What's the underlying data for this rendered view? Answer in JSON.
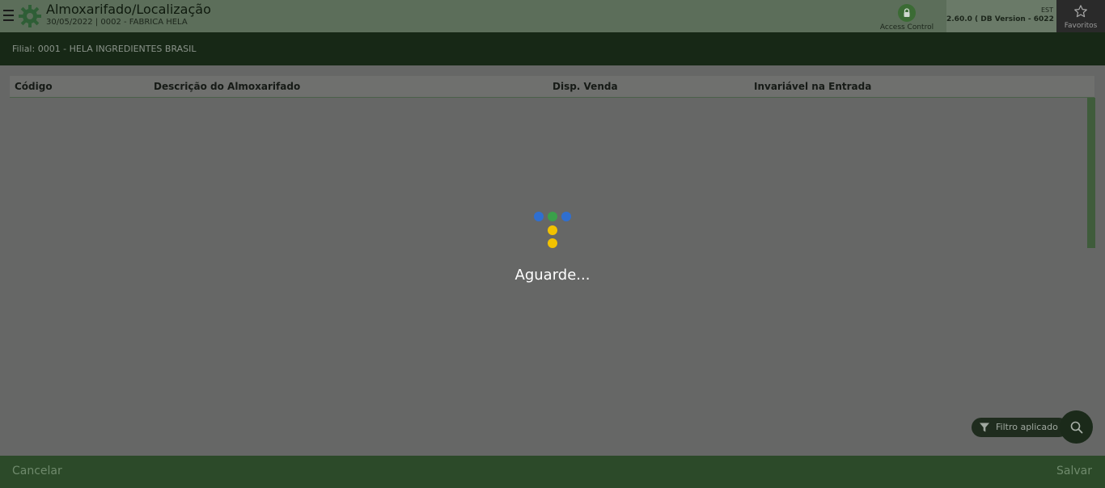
{
  "header": {
    "title": "Almoxarifado/Localização",
    "subtitle": "30/05/2022 | 0002 - FABRICA HELA",
    "access_control_label": "Access Control",
    "version_env": "EST",
    "version_text": "2.60.0 ( DB Version - 6022 )",
    "favorites_label": "Favoritos"
  },
  "filial": {
    "text": "Filial: 0001 - HELA INGREDIENTES BRASIL"
  },
  "table": {
    "columns": [
      "Código",
      "Descrição do Almoxarifado",
      "Disp. Venda",
      "Invariável na Entrada"
    ]
  },
  "loader": {
    "text": "Aguarde...",
    "dot_colors": [
      "#2f6fd0",
      "#3aa04a",
      "#2f6fd0",
      "#f2c200",
      "#f2c200"
    ]
  },
  "filter": {
    "label": "Filtro aplicado"
  },
  "footer": {
    "cancel_label": "Cancelar",
    "save_label": "Salvar"
  },
  "icons": {
    "menu": "menu-icon",
    "logo": "gear-logo-icon",
    "lock": "lock-icon",
    "star": "star-icon",
    "filter": "filter-icon",
    "search": "search-icon"
  },
  "colors": {
    "header_bg": "#5c6e5a",
    "filial_bg": "#172816",
    "footer_bg": "#2c4a29",
    "accent": "#3b6b34"
  }
}
